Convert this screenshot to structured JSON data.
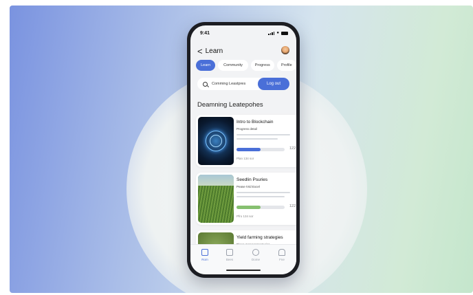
{
  "status_bar": {
    "time": "9:41"
  },
  "header": {
    "back_symbol": "<",
    "title": "Learn"
  },
  "tabs": [
    {
      "label": "Learn",
      "active": true
    },
    {
      "label": "Community",
      "active": false
    },
    {
      "label": "Progress",
      "active": false
    },
    {
      "label": "Profile",
      "active": false
    }
  ],
  "search": {
    "text": "Comming Leastpres"
  },
  "logout": {
    "label": "Log out"
  },
  "section": {
    "title": "Deamning Leatepohes"
  },
  "cards": [
    {
      "title": "Intro to Blockchain",
      "subtitle": "Progress detail",
      "progress_value": "122",
      "progress": 0.5,
      "footer": "Plan 134 sor",
      "accent": "#4a6fd8"
    },
    {
      "title": "Seedlin Psuries",
      "subtitle": "Pease IVid Excel",
      "progress_value": "122",
      "progress": 0.5,
      "footer": "Pfro 134 sor",
      "accent": "#86c070"
    },
    {
      "title": "Yield farming strategies",
      "subtitle": "Dipea management sies",
      "progress_value": "",
      "progress": 0,
      "footer": "",
      "accent": "#86c070"
    }
  ],
  "nav": [
    {
      "label": "Rom",
      "icon": "home-icon",
      "active": true
    },
    {
      "label": "Bees",
      "icon": "book-icon",
      "active": false
    },
    {
      "label": "Dome",
      "icon": "user-icon",
      "active": false
    },
    {
      "label": "Fne",
      "icon": "bell-icon",
      "active": false
    }
  ],
  "colors": {
    "accent": "#4a6fd8",
    "green": "#86c070"
  }
}
